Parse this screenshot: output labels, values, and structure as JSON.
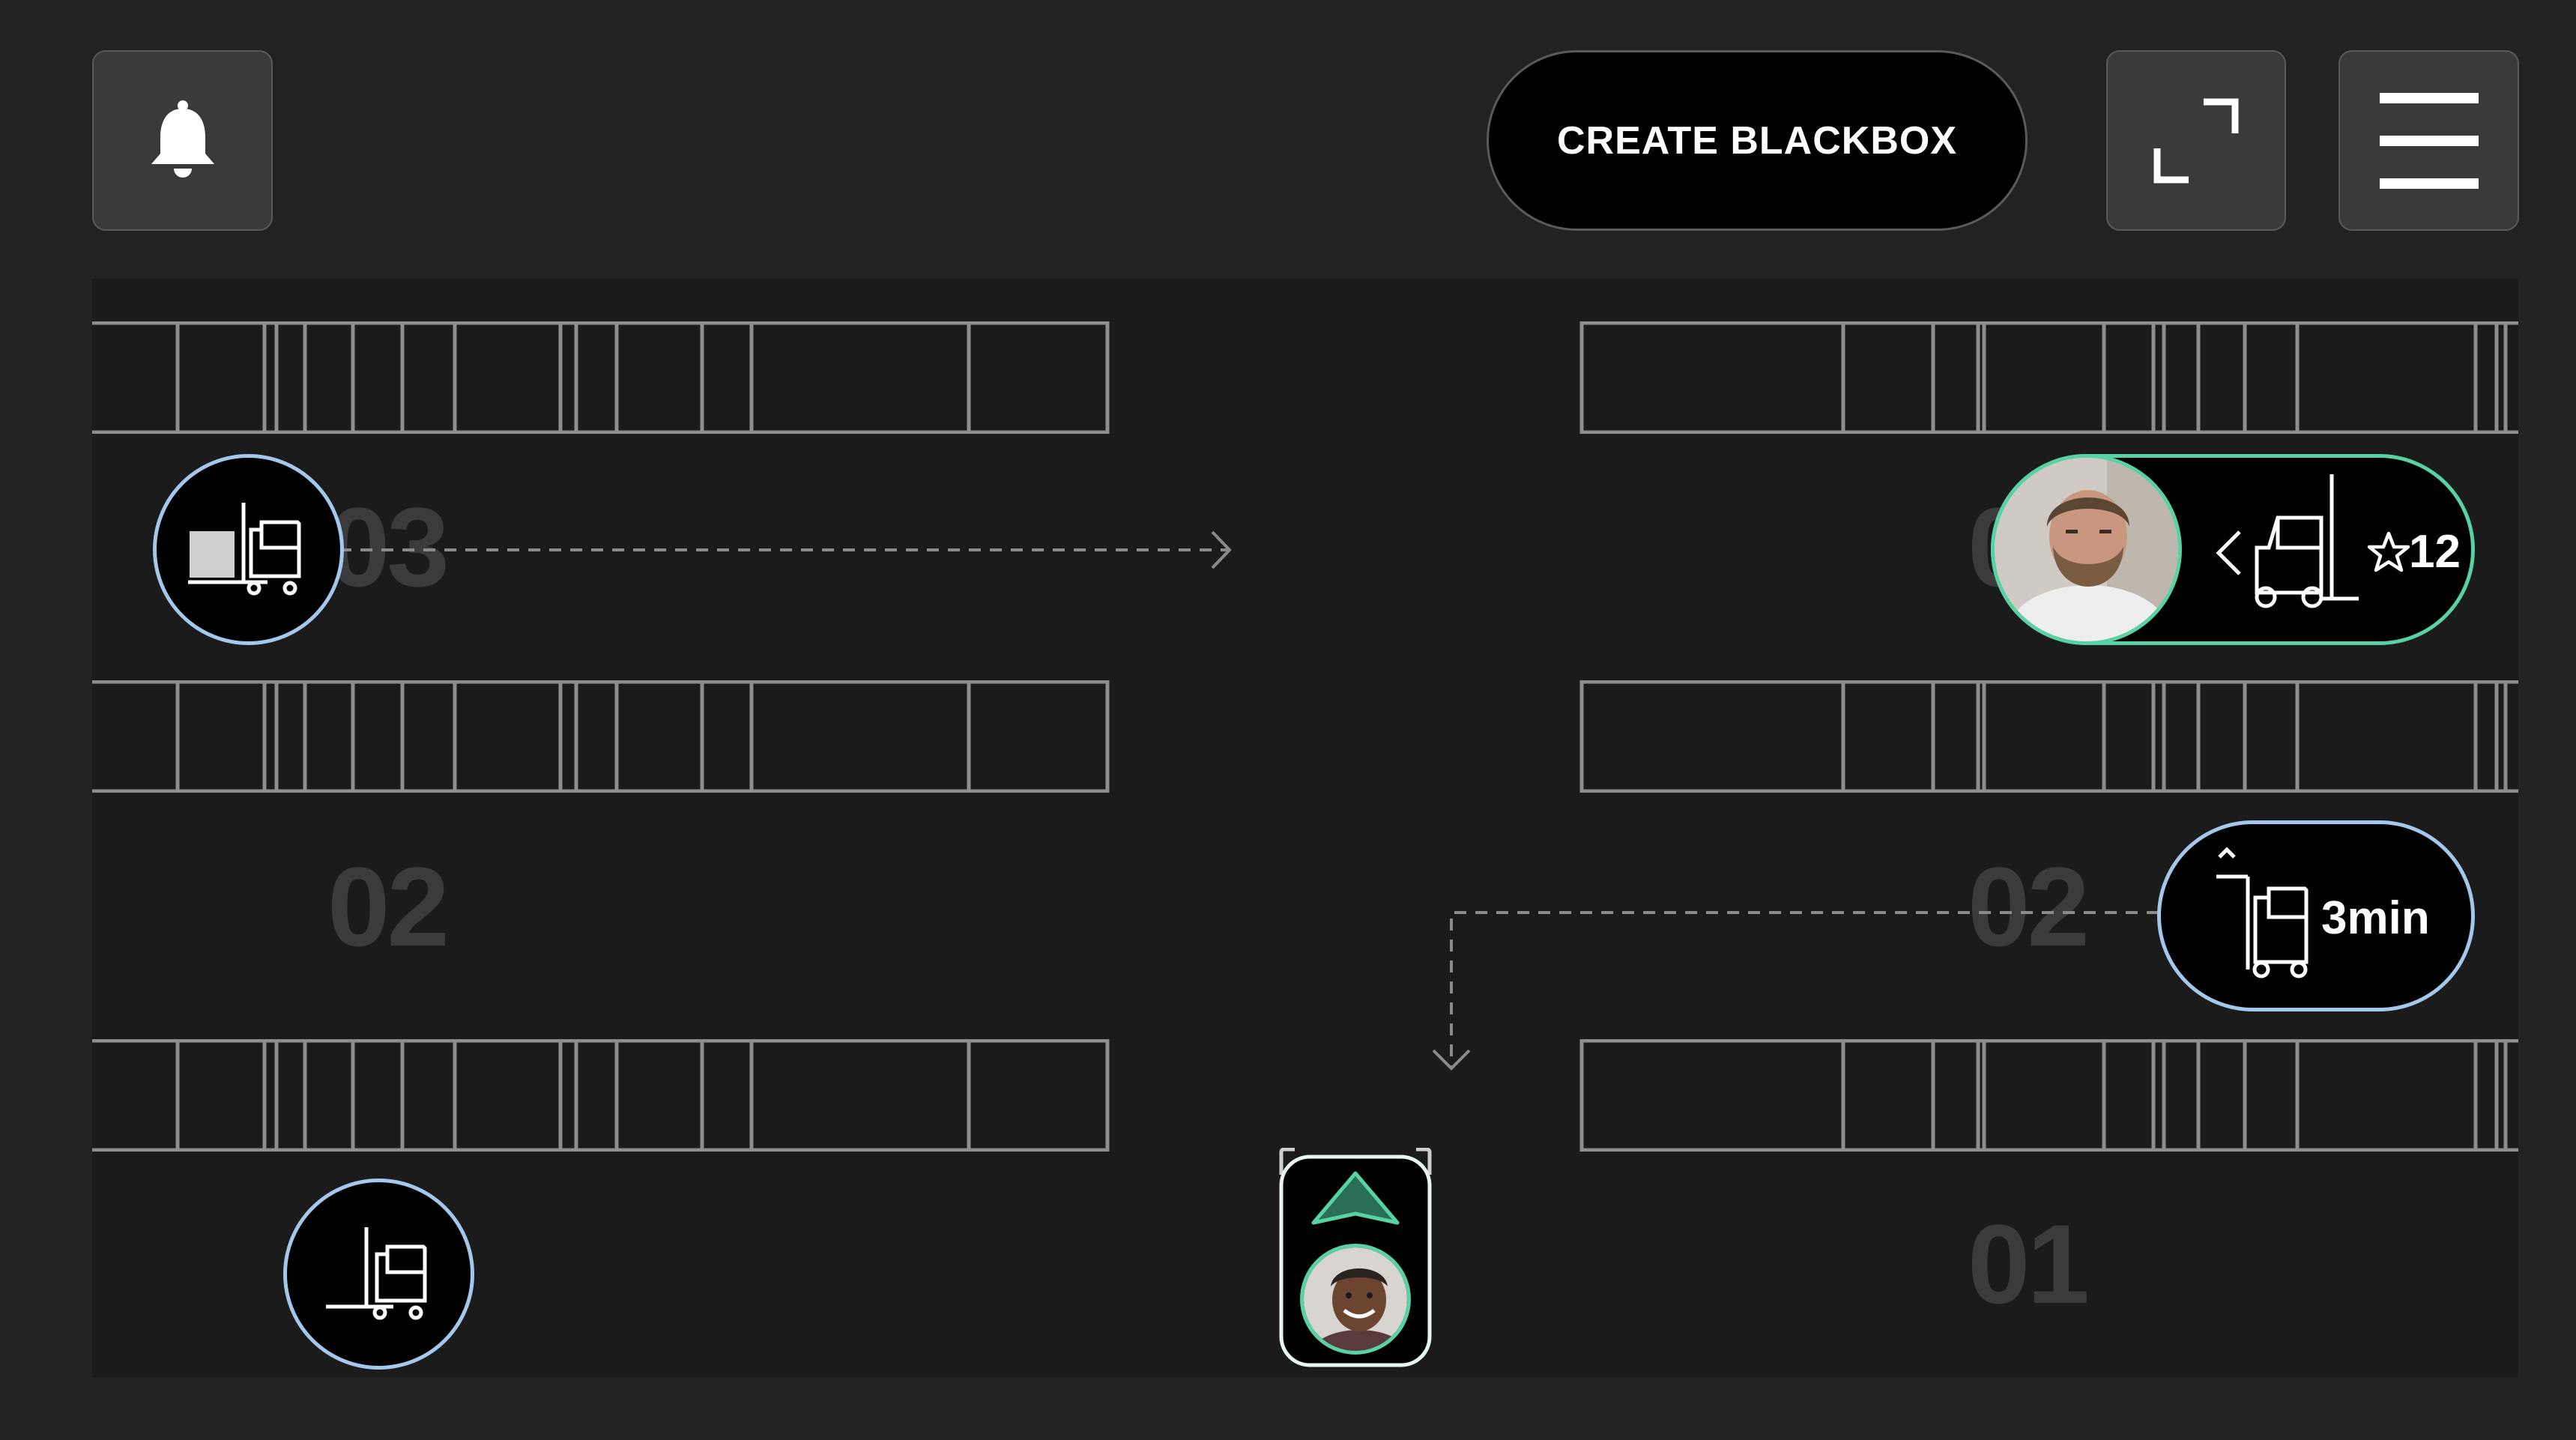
{
  "header": {
    "create_label": "CREATE BLACKBOX"
  },
  "icons": {
    "notification": "bell-icon",
    "expand": "expand-icon",
    "menu": "hamburger-menu-icon",
    "forklift": "forklift-icon",
    "star": "star-icon",
    "chevron": "chevron-left-icon",
    "direction": "navigation-arrow-icon"
  },
  "aisles": {
    "left_top": "03",
    "left_middle": "02",
    "right_top": "03",
    "right_middle": "02",
    "right_bottom": "01"
  },
  "badges": {
    "rating_value": "12",
    "eta_value": "3min"
  },
  "colors": {
    "background": "#222222",
    "map": "#1b1b1b",
    "rack_line": "#8e8e8e",
    "badge_blue": "#a4c7ec",
    "badge_green": "#58d1a4"
  }
}
